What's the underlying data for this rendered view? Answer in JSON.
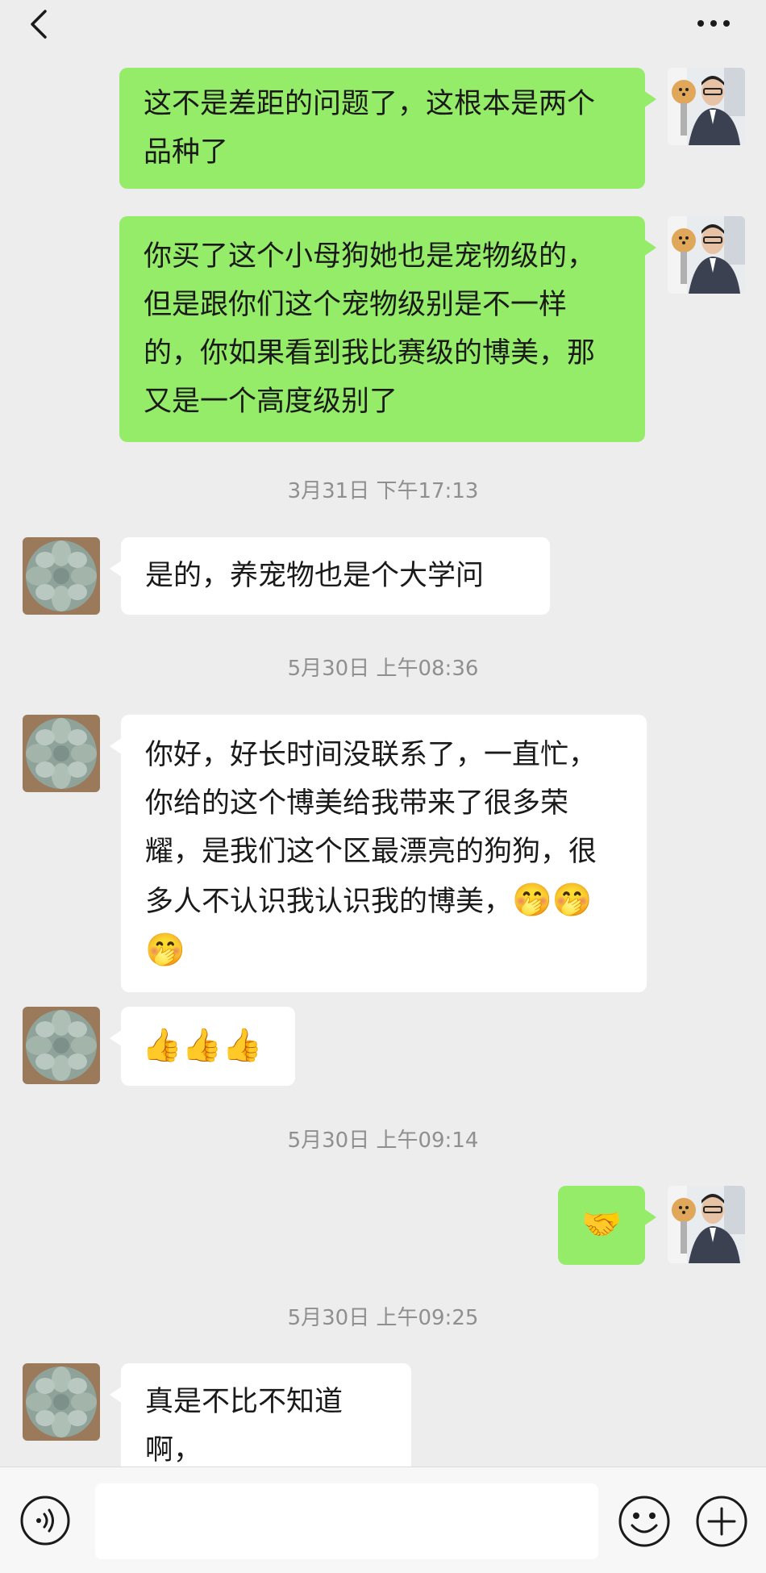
{
  "header": {
    "back_icon": "chevron-left-icon",
    "more_icon": "ellipsis-icon"
  },
  "messages": [
    {
      "from": "me",
      "text": "这不是差距的问题了，这根本是两个品种了"
    },
    {
      "from": "me",
      "text": "你买了这个小母狗她也是宠物级的，但是跟你们这个宠物级别是不一样的，你如果看到我比赛级的博美，那又是一个高度级别了"
    },
    {
      "type": "time",
      "text": "3月31日 下午17:13"
    },
    {
      "from": "them",
      "text": "是的，养宠物也是个大学问"
    },
    {
      "type": "time",
      "text": "5月30日 上午08:36"
    },
    {
      "from": "them",
      "text": "你好，好长时间没联系了，一直忙，你给的这个博美给我带来了很多荣耀，是我们这个区最漂亮的狗狗，很多人不认识我认识我的博美，",
      "emoji": "🤭🤭🤭"
    },
    {
      "from": "them",
      "emoji": "👍👍👍"
    },
    {
      "type": "time",
      "text": "5月30日 上午09:14"
    },
    {
      "from": "me",
      "emoji": "🤝"
    },
    {
      "type": "time",
      "text": "5月30日 上午09:25"
    },
    {
      "from": "them",
      "text": "真是不比不知道啊，"
    }
  ],
  "input_bar": {
    "voice_icon": "voice-icon",
    "emoji_icon": "smiley-icon",
    "plus_icon": "plus-icon",
    "input_value": ""
  },
  "colors": {
    "background": "#ededed",
    "my_bubble": "#95ec69",
    "their_bubble": "#ffffff",
    "timestamp": "#8f8f8f"
  }
}
